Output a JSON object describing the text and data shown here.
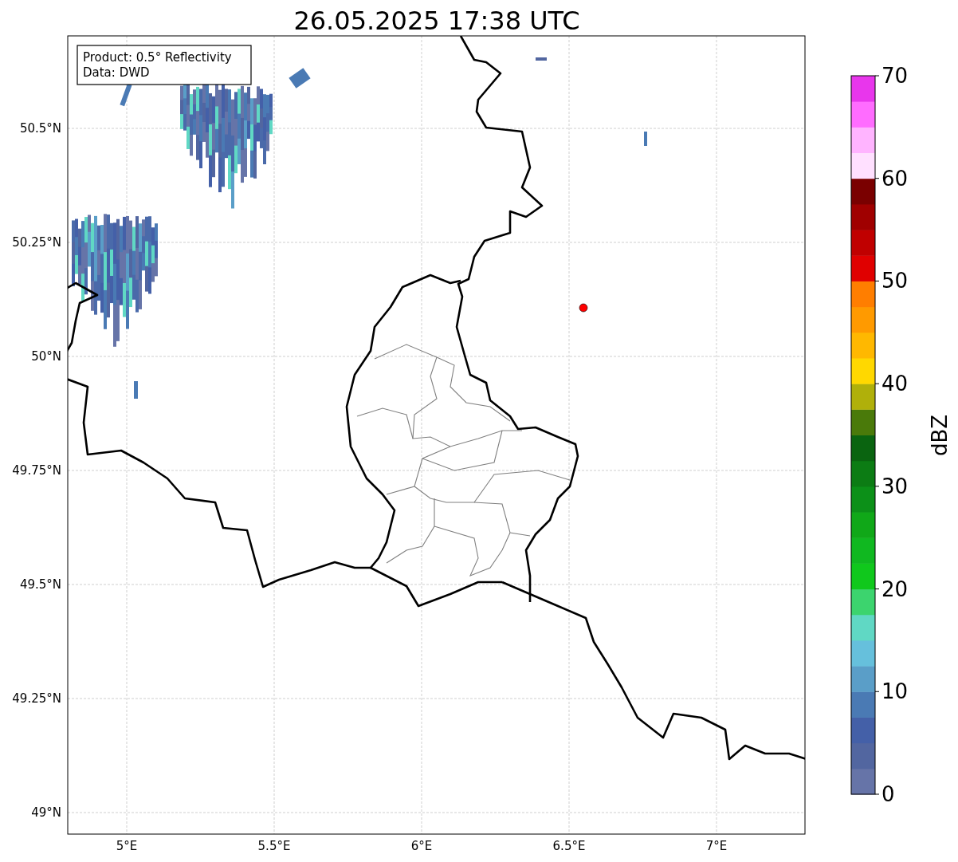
{
  "title": "26.05.2025 17:38 UTC",
  "info_box": [
    "Product: 0.5° Reflectivity",
    "Data: DWD"
  ],
  "map": {
    "lat_ticks": [
      "50.5°N",
      "50.25°N",
      "50°N",
      "49.75°N",
      "49.5°N",
      "49.25°N",
      "49°N"
    ],
    "lon_ticks": [
      "5°E",
      "5.5°E",
      "6°E",
      "6.5°E",
      "7°E"
    ]
  },
  "colorbar": {
    "label": "dBZ",
    "ticks": [
      "70",
      "60",
      "50",
      "40",
      "30",
      "20",
      "10",
      "0"
    ],
    "bins": [
      {
        "color": "#6674a8"
      },
      {
        "color": "#5266a0"
      },
      {
        "color": "#4460a8"
      },
      {
        "color": "#4a7ab4"
      },
      {
        "color": "#5a9ec8"
      },
      {
        "color": "#66c0dc"
      },
      {
        "color": "#60d8c4"
      },
      {
        "color": "#3cd46e"
      },
      {
        "color": "#10c81c"
      },
      {
        "color": "#10b820"
      },
      {
        "color": "#10a818"
      },
      {
        "color": "#0c9018"
      },
      {
        "color": "#0c7c14"
      },
      {
        "color": "#0a6410"
      },
      {
        "color": "#4a7a0a"
      },
      {
        "color": "#b0b00a"
      },
      {
        "color": "#ffd800"
      },
      {
        "color": "#ffb800"
      },
      {
        "color": "#ff9a00"
      },
      {
        "color": "#ff7e00"
      },
      {
        "color": "#e00000"
      },
      {
        "color": "#c00000"
      },
      {
        "color": "#a00000"
      },
      {
        "color": "#7a0000"
      },
      {
        "color": "#ffe0ff"
      },
      {
        "color": "#ffb4ff"
      },
      {
        "color": "#ff6cff"
      },
      {
        "color": "#e836ec"
      }
    ]
  }
}
